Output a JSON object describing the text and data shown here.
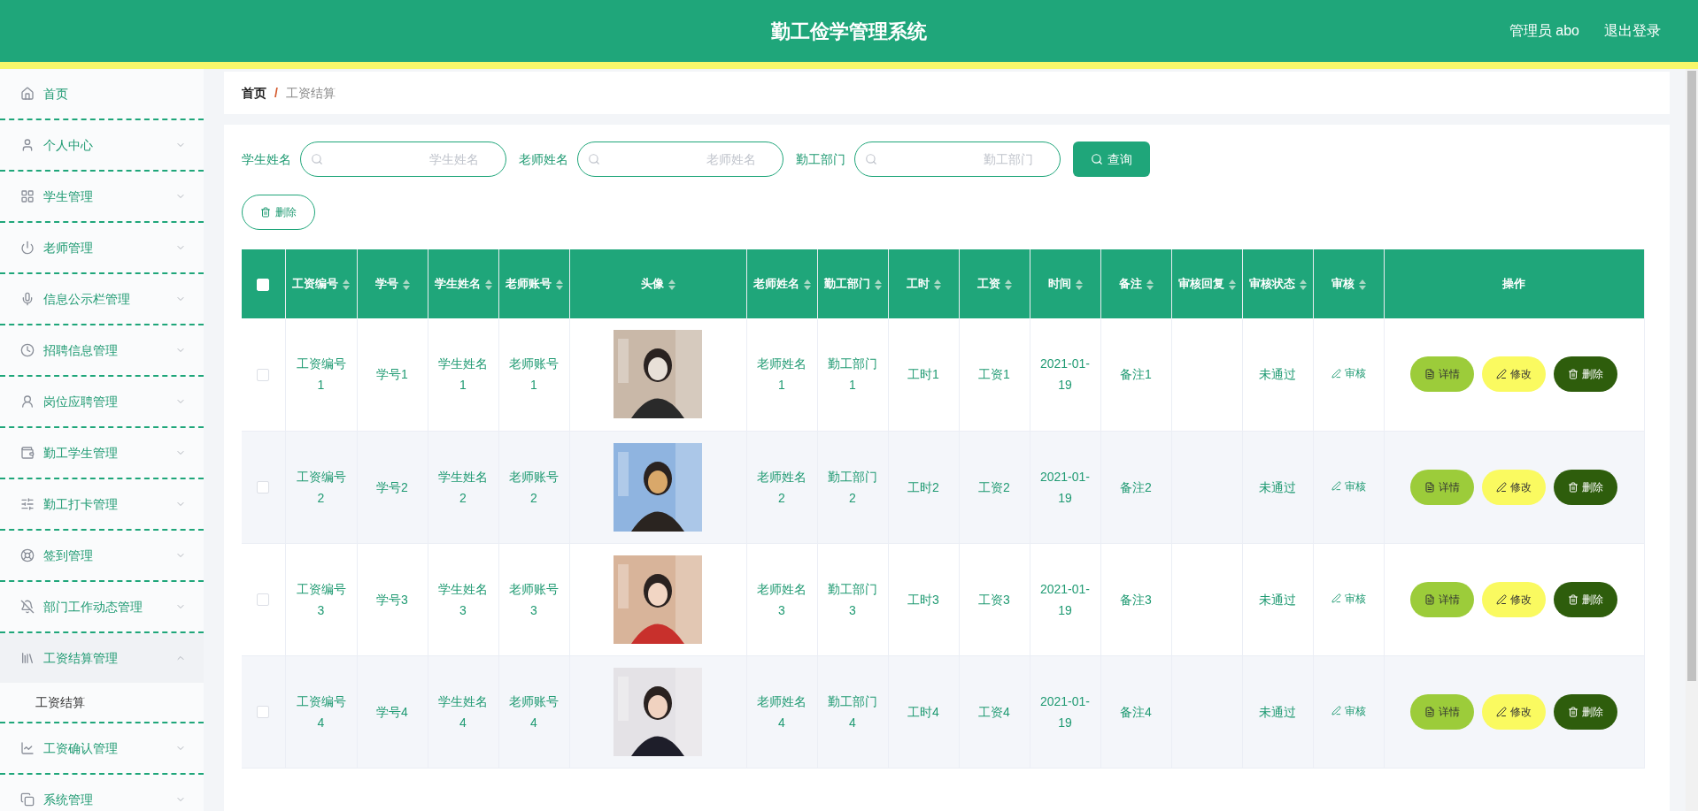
{
  "header": {
    "title": "勤工俭学管理系统",
    "user": "管理员 abo",
    "logout": "退出登录"
  },
  "sidebar": {
    "items": [
      {
        "label": "首页",
        "has_arrow": false
      },
      {
        "label": "个人中心",
        "has_arrow": true,
        "expanded": false
      },
      {
        "label": "学生管理",
        "has_arrow": true,
        "expanded": false
      },
      {
        "label": "老师管理",
        "has_arrow": true,
        "expanded": false
      },
      {
        "label": "信息公示栏管理",
        "has_arrow": true,
        "expanded": false
      },
      {
        "label": "招聘信息管理",
        "has_arrow": true,
        "expanded": false
      },
      {
        "label": "岗位应聘管理",
        "has_arrow": true,
        "expanded": false
      },
      {
        "label": "勤工学生管理",
        "has_arrow": true,
        "expanded": false
      },
      {
        "label": "勤工打卡管理",
        "has_arrow": true,
        "expanded": false
      },
      {
        "label": "签到管理",
        "has_arrow": true,
        "expanded": false
      },
      {
        "label": "部门工作动态管理",
        "has_arrow": true,
        "expanded": false
      },
      {
        "label": "工资结算管理",
        "has_arrow": true,
        "expanded": true,
        "children": [
          {
            "label": "工资结算"
          }
        ]
      },
      {
        "label": "工资确认管理",
        "has_arrow": true,
        "expanded": false
      },
      {
        "label": "系统管理",
        "has_arrow": true,
        "expanded": false
      }
    ]
  },
  "breadcrumb": [
    "首页",
    "工资结算"
  ],
  "breadcrumb_separator": "/",
  "search": {
    "fields": [
      {
        "label": "学生姓名",
        "placeholder": "学生姓名"
      },
      {
        "label": "老师姓名",
        "placeholder": "老师姓名"
      },
      {
        "label": "勤工部门",
        "placeholder": "勤工部门"
      }
    ],
    "button": "查询"
  },
  "delete_button": "删除",
  "table": {
    "select_all": {
      "checked": false
    },
    "columns": [
      {
        "label": "工资编号",
        "sortable": true
      },
      {
        "label": "学号",
        "sortable": true
      },
      {
        "label": "学生姓名",
        "sortable": true
      },
      {
        "label": "老师账号",
        "sortable": true
      },
      {
        "label": "头像",
        "sortable": true
      },
      {
        "label": "老师姓名",
        "sortable": true
      },
      {
        "label": "勤工部门",
        "sortable": true
      },
      {
        "label": "工时",
        "sortable": true
      },
      {
        "label": "工资",
        "sortable": true
      },
      {
        "label": "时间",
        "sortable": true
      },
      {
        "label": "备注",
        "sortable": true
      },
      {
        "label": "审核回复",
        "sortable": true
      },
      {
        "label": "审核状态",
        "sortable": true
      },
      {
        "label": "审核",
        "sortable": true
      },
      {
        "label": "操作",
        "sortable": false
      }
    ],
    "rows": [
      {
        "checked": false,
        "cells": [
          "工资编号1",
          "学号1",
          "学生姓名1",
          "老师账号1",
          {
            "kind": "picture"
          },
          "老师姓名1",
          "勤工部门1",
          "工时1",
          "工资1",
          "2021-01-19",
          "备注1",
          "",
          "未通过"
        ],
        "review": "审核",
        "actions": [
          "详情",
          "修改",
          "删除"
        ]
      },
      {
        "checked": false,
        "cells": [
          "工资编号2",
          "学号2",
          "学生姓名2",
          "老师账号2",
          {
            "kind": "picture"
          },
          "老师姓名2",
          "勤工部门2",
          "工时2",
          "工资2",
          "2021-01-19",
          "备注2",
          "",
          "未通过"
        ],
        "review": "审核",
        "actions": [
          "详情",
          "修改",
          "删除"
        ]
      },
      {
        "checked": false,
        "cells": [
          "工资编号3",
          "学号3",
          "学生姓名3",
          "老师账号3",
          {
            "kind": "picture"
          },
          "老师姓名3",
          "勤工部门3",
          "工时3",
          "工资3",
          "2021-01-19",
          "备注3",
          "",
          "未通过"
        ],
        "review": "审核",
        "actions": [
          "详情",
          "修改",
          "删除"
        ]
      },
      {
        "checked": false,
        "cells": [
          "工资编号4",
          "学号4",
          "学生姓名4",
          "老师账号4",
          {
            "kind": "picture"
          },
          "老师姓名4",
          "勤工部门4",
          "工时4",
          "工资4",
          "2021-01-19",
          "备注4",
          "",
          "未通过"
        ],
        "review": "审核",
        "actions": [
          "详情",
          "修改",
          "删除"
        ]
      }
    ]
  }
}
